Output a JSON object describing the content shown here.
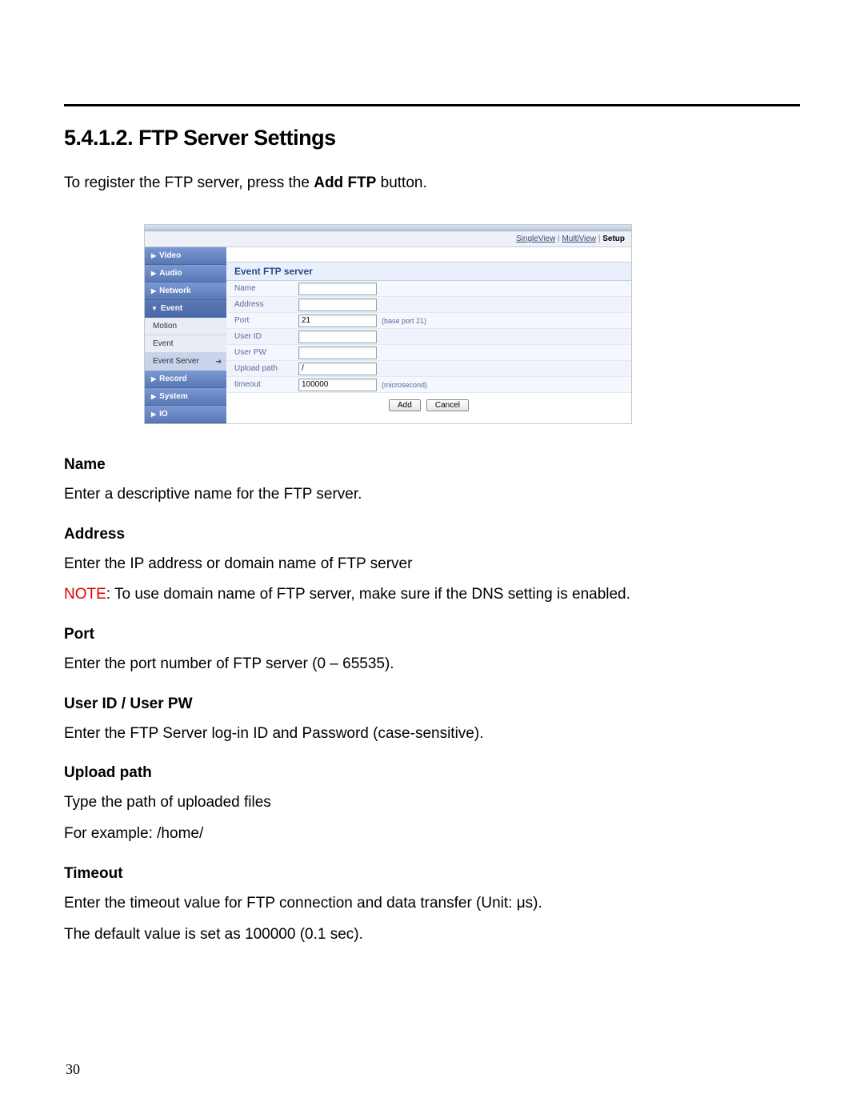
{
  "heading": "5.4.1.2. FTP Server Settings",
  "intro_pre": "To register the FTP server, press the ",
  "intro_bold": "Add FTP",
  "intro_post": " button.",
  "toplinks": {
    "single": "SingleView",
    "multi": "MultiView",
    "setup": "Setup",
    "sep": " | "
  },
  "sidebar": {
    "video": "Video",
    "audio": "Audio",
    "network": "Network",
    "event": "Event",
    "motion": "Motion",
    "event_sub": "Event",
    "event_server": "Event Server",
    "record": "Record",
    "system": "System",
    "io": "IO"
  },
  "form": {
    "header": "Event FTP server",
    "name_label": "Name",
    "name_value": "",
    "address_label": "Address",
    "address_value": "",
    "port_label": "Port",
    "port_value": "21",
    "port_hint": "(base port 21)",
    "userid_label": "User ID",
    "userid_value": "",
    "userpw_label": "User PW",
    "userpw_value": "",
    "upload_label": "Upload path",
    "upload_value": "/",
    "timeout_label": "timeout",
    "timeout_value": "100000",
    "timeout_hint": "(microsecond)",
    "add_btn": "Add",
    "cancel_btn": "Cancel"
  },
  "desc": {
    "name_h": "Name",
    "name_t": "Enter a descriptive name for the FTP server.",
    "addr_h": "Address",
    "addr_t": "Enter the IP address or domain name of FTP server",
    "addr_note_red": "NOTE",
    "addr_note_rest": ": To use domain name of FTP server, make sure if the DNS setting is enabled.",
    "port_h": "Port",
    "port_t": "Enter the port number of FTP server (0 – 65535).",
    "user_h": "User ID / User PW",
    "user_t": "Enter the FTP Server log-in ID and Password (case-sensitive).",
    "upload_h": "Upload path",
    "upload_t1": "Type the path of uploaded files",
    "upload_t2": "For example: /home/",
    "timeout_h": "Timeout",
    "timeout_t1": "Enter the timeout value for FTP connection and data transfer (Unit: μs).",
    "timeout_t2": "The default value is set as 100000 (0.1 sec)."
  },
  "page_number": "30"
}
